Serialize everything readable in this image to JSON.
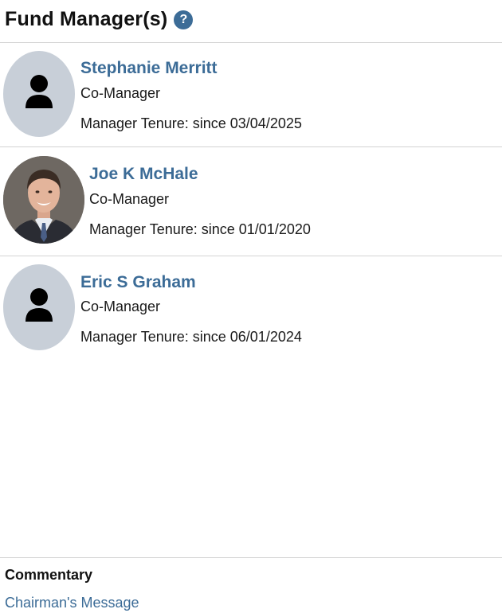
{
  "header": {
    "title": "Fund Manager(s)",
    "help_icon": "?"
  },
  "managers": [
    {
      "name": "Stephanie Merritt",
      "role": "Co-Manager",
      "tenure": "Manager Tenure: since 03/04/2025",
      "avatar": "person-silhouette-icon"
    },
    {
      "name": "Joe K McHale",
      "role": "Co-Manager",
      "tenure": "Manager Tenure: since 01/01/2020",
      "avatar": "headshot-photo"
    },
    {
      "name": "Eric S Graham",
      "role": "Co-Manager",
      "tenure": "Manager Tenure: since 06/01/2024",
      "avatar": "person-silhouette-icon"
    }
  ],
  "commentary": {
    "title": "Commentary",
    "link": "Chairman's Message"
  },
  "colors": {
    "link": "#3c6c97",
    "avatar_bg": "#c8cfd8",
    "divider": "#d3d3d3"
  }
}
